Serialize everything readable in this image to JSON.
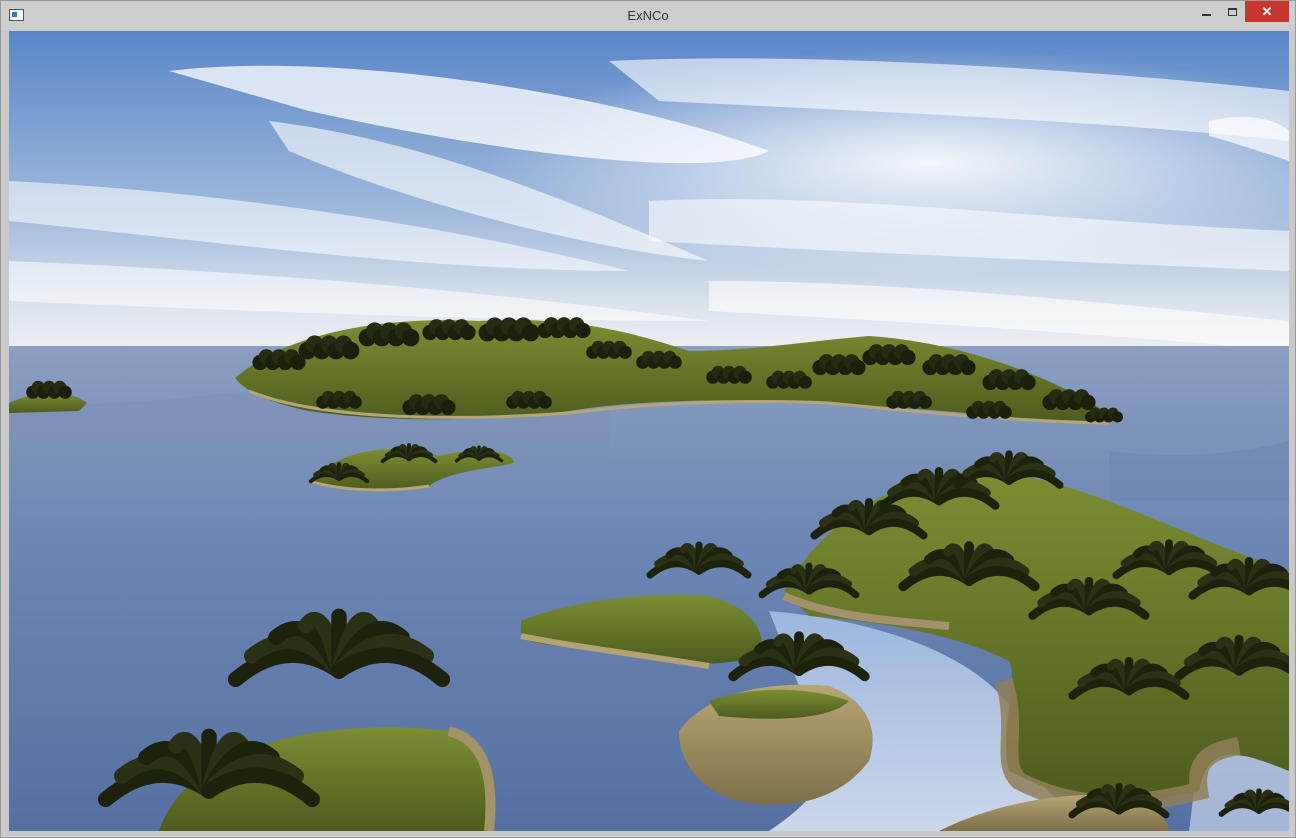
{
  "window": {
    "title": "ExNCo",
    "close_label": "✕"
  },
  "scene": {
    "colors": {
      "sky_top": "#5b86c7",
      "sky_horizon": "#e6ebf1",
      "water_far": "#7f95b8",
      "water_near": "#5b77a8",
      "island_green": "#5f7228",
      "sand": "#b4a472",
      "palm_dark": "#1f2410"
    }
  }
}
